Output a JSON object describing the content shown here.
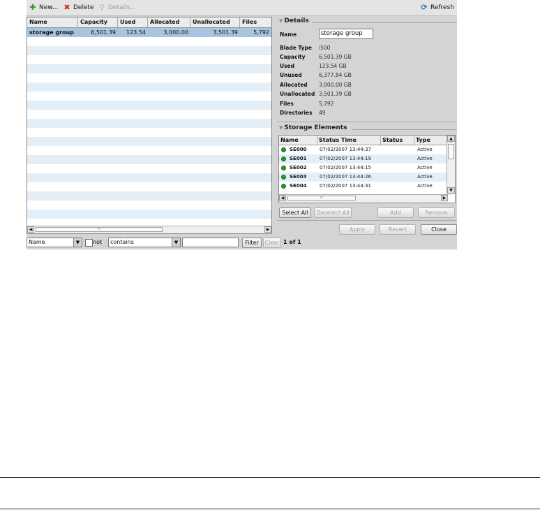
{
  "toolbar": {
    "new_label": "New...",
    "delete_label": "Delete",
    "details_label": "Details...",
    "refresh_label": "Refresh"
  },
  "grid": {
    "columns": [
      "Name",
      "Capacity",
      "Used",
      "Allocated",
      "Unallocated",
      "Files"
    ],
    "rows": [
      {
        "name": "storage group",
        "capacity": "6,501.39",
        "used": "123.54",
        "allocated": "3,000.00",
        "unallocated": "3,501.39",
        "files": "5,792"
      }
    ],
    "scroll_text": "III"
  },
  "filter": {
    "field": "Name",
    "not_label": "not",
    "operator": "contains",
    "value": "",
    "filter_button": "Filter",
    "clear_button": "Clear",
    "paging": "1 of 1"
  },
  "details": {
    "title": "Details",
    "name_label": "Name",
    "name_value": "storage group",
    "fields": [
      {
        "label": "Blade Type",
        "value": "i500"
      },
      {
        "label": "Capacity",
        "value": "6,501.39 GB"
      },
      {
        "label": "Used",
        "value": "123.54 GB"
      },
      {
        "label": "Unused",
        "value": "6,377.84 GB"
      },
      {
        "label": "Allocated",
        "value": "3,000.00 GB"
      },
      {
        "label": "Unallocated",
        "value": "3,501.39 GB"
      },
      {
        "label": "Files",
        "value": "5,792"
      },
      {
        "label": "Directories",
        "value": "49"
      }
    ]
  },
  "storage_elements": {
    "title": "Storage Elements",
    "columns": [
      "Name",
      "Status Time",
      "Status",
      "Type"
    ],
    "rows": [
      {
        "name": "SE000",
        "time": "07/02/2007 13:44:37",
        "status": "",
        "type": "Active"
      },
      {
        "name": "SE001",
        "time": "07/02/2007 13:44:19",
        "status": "",
        "type": "Active"
      },
      {
        "name": "SE002",
        "time": "07/02/2007 13:44:15",
        "status": "",
        "type": "Active"
      },
      {
        "name": "SE003",
        "time": "07/02/2007 13:44:26",
        "status": "",
        "type": "Active"
      },
      {
        "name": "SE004",
        "time": "07/02/2007 13:44:31",
        "status": "",
        "type": "Active"
      }
    ],
    "scroll_text": "III",
    "select_all": "Select All",
    "deselect_all": "Deselect All",
    "add": "Add",
    "remove": "Remove"
  },
  "footer": {
    "apply": "Apply",
    "revert": "Revert",
    "close": "Close"
  },
  "colors": {
    "selected_row": "#a8c4e0",
    "alt_row": "#e4eef6",
    "status_ok": "#2a9a2a",
    "panel_bg": "#d4d4d4"
  }
}
